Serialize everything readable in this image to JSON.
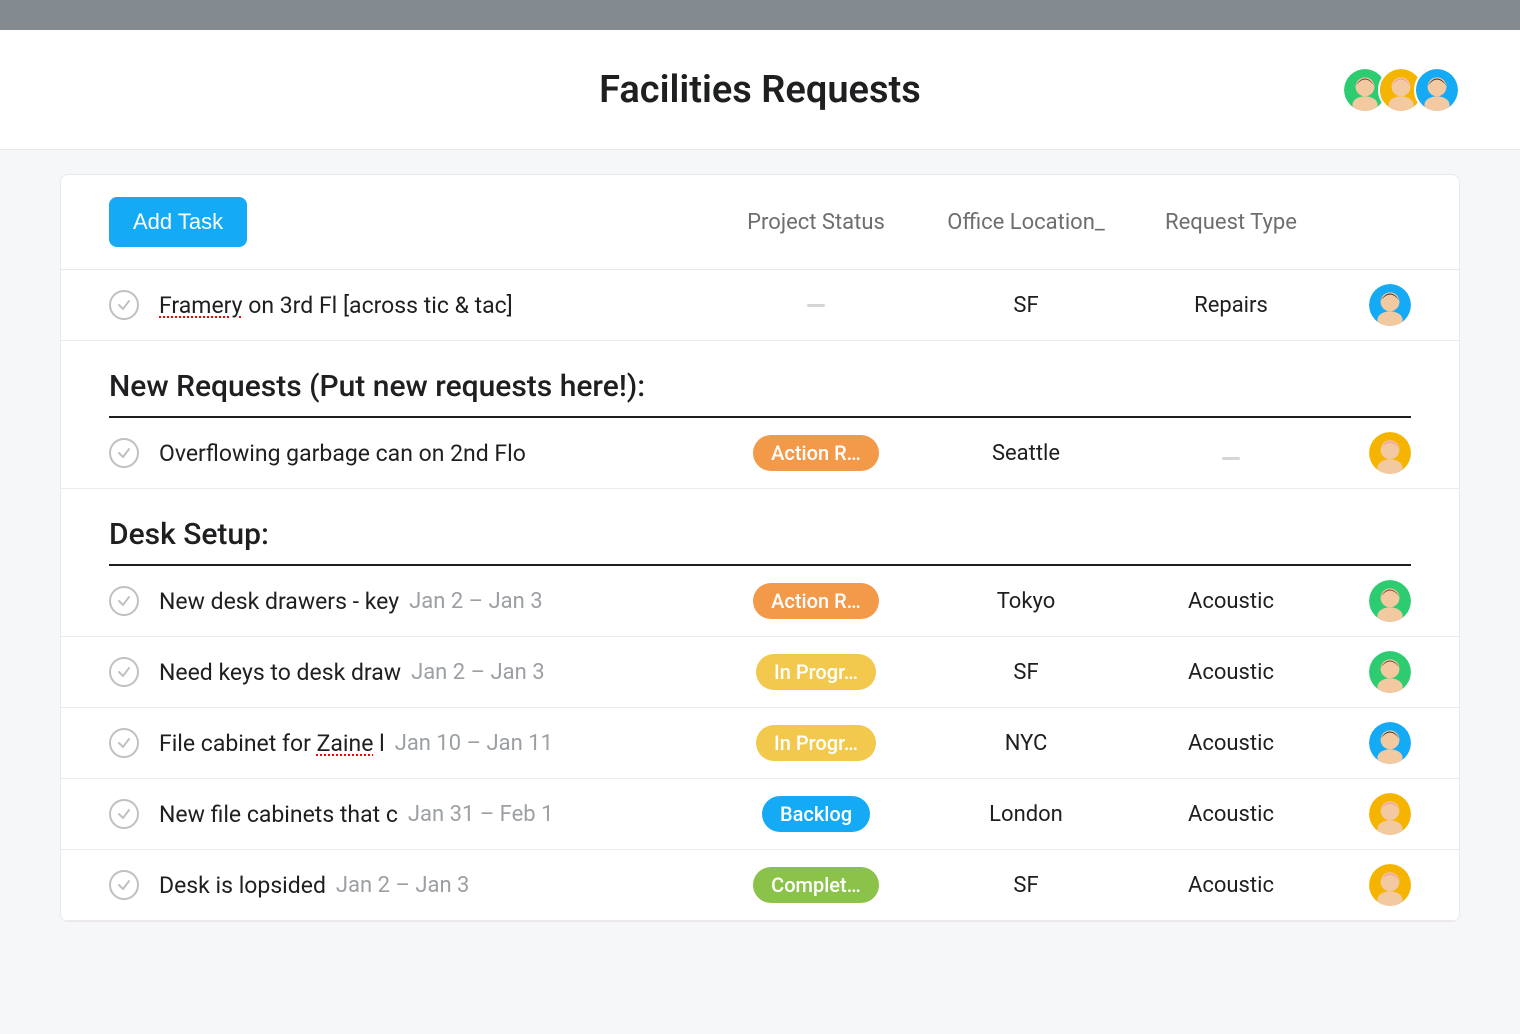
{
  "header": {
    "title": "Facilities Requests",
    "avatars": [
      "green",
      "yellow",
      "blue"
    ]
  },
  "addTask": {
    "label": "Add Task"
  },
  "columns": {
    "status": "Project Status",
    "location": "Office Location_",
    "type": "Request Type"
  },
  "statusColors": {
    "action": "#f2994a",
    "inprogress": "#f2c94c",
    "backlog": "#14aaf5",
    "completed": "#8bc34a"
  },
  "ungrouped": [
    {
      "name_prefix_spell": "Framery",
      "name_suffix": " on 3rd Fl [across tic & tac]",
      "status": null,
      "location": "SF",
      "type": "Repairs",
      "avatar": "blue"
    }
  ],
  "sections": [
    {
      "title": "New Requests (Put new requests here!):",
      "tasks": [
        {
          "name": "Overflowing garbage can on 2nd Flo",
          "status": "Action R…",
          "statusKey": "action",
          "location": "Seattle",
          "type": null,
          "avatar": "yellow"
        }
      ]
    },
    {
      "title": "Desk Setup:",
      "tasks": [
        {
          "name": "New desk drawers - key",
          "date": "Jan 2 – Jan 3",
          "status": "Action R…",
          "statusKey": "action",
          "location": "Tokyo",
          "type": "Acoustic",
          "avatar": "green"
        },
        {
          "name": "Need keys to desk draw",
          "date": "Jan 2 – Jan 3",
          "status": "In Progr…",
          "statusKey": "inprogress",
          "location": "SF",
          "type": "Acoustic",
          "avatar": "green"
        },
        {
          "name_prefix": "File cabinet for ",
          "name_spell": "Zaine",
          "name_suffix2": " l",
          "date": "Jan 10 – Jan 11",
          "status": "In Progr…",
          "statusKey": "inprogress",
          "location": "NYC",
          "type": "Acoustic",
          "avatar": "blue"
        },
        {
          "name": "New file cabinets that c",
          "date": "Jan 31 – Feb 1",
          "status": "Backlog",
          "statusKey": "backlog",
          "location": "London",
          "type": "Acoustic",
          "avatar": "yellow"
        },
        {
          "name": "Desk is lopsided",
          "date": "Jan 2 – Jan 3",
          "status": "Complet…",
          "statusKey": "completed",
          "location": "SF",
          "type": "Acoustic",
          "avatar": "yellow"
        }
      ]
    }
  ]
}
